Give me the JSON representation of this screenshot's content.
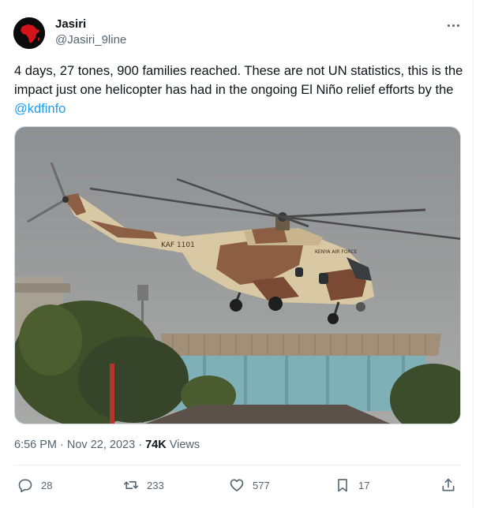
{
  "author": {
    "display_name": "Jasiri",
    "handle": "@Jasiri_9line",
    "avatar_icon": "africa-map-avatar"
  },
  "tweet": {
    "text": "4 days, 27 tones, 900 families reached. These are not UN statistics, this is the impact just one helicopter has had in the ongoing El Niño relief efforts by the ",
    "mention": "@kdfinfo"
  },
  "media": {
    "helicopter_markings": {
      "tail": "KAF 1101",
      "nose": "KENYA AIR FORCE"
    }
  },
  "meta": {
    "time": "6:56 PM",
    "separator": "·",
    "date": "Nov 22, 2023",
    "views_count": "74K",
    "views_label": "Views"
  },
  "actions": {
    "reply_count": "28",
    "repost_count": "233",
    "like_count": "577",
    "bookmark_count": "17"
  },
  "colors": {
    "accent": "#1d9bf0",
    "secondary_text": "#536471",
    "avatar_map": "#d4141a"
  }
}
